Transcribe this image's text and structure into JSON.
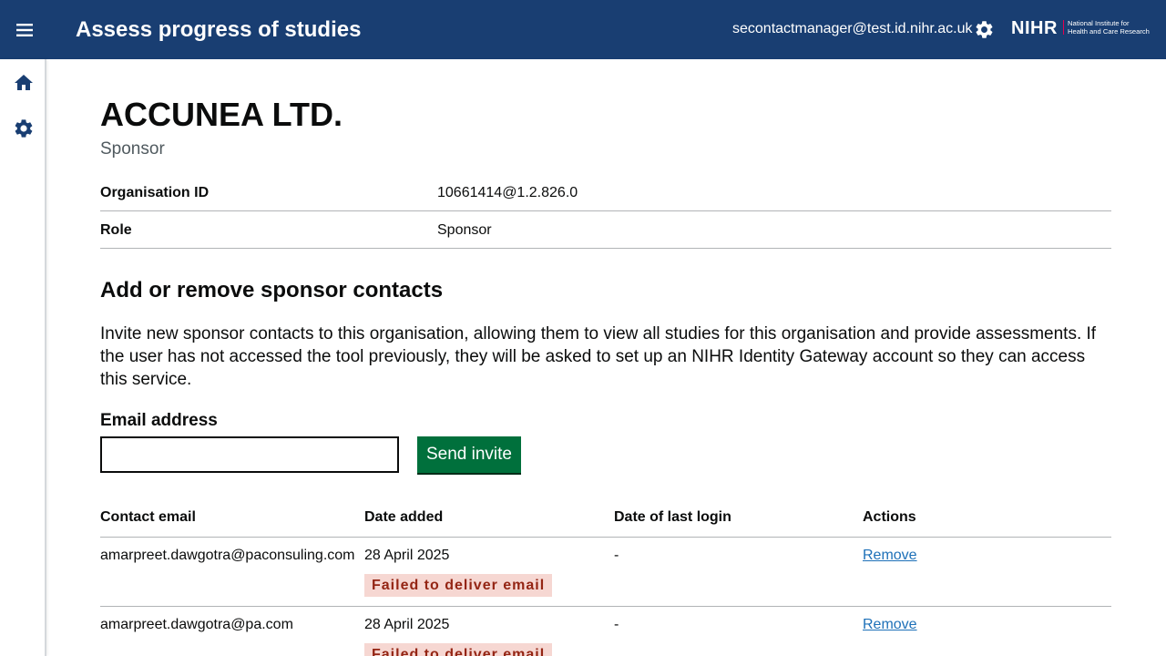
{
  "header": {
    "title": "Assess progress of studies",
    "user_email": "secontactmanager@test.id.nihr.ac.uk",
    "logo_text": "NIHR",
    "logo_line1": "National Institute for",
    "logo_line2": "Health and Care Research"
  },
  "icons": {
    "menu": "menu-icon",
    "settings_header": "gear-icon",
    "home": "home-icon",
    "settings_nav": "gear-icon"
  },
  "colors": {
    "header_bg": "#193e72",
    "button_green": "#00703c",
    "link_blue": "#1d70b8",
    "tag_bg": "#f6d7d2",
    "tag_text": "#942514"
  },
  "organisation": {
    "name": "ACCUNEA LTD.",
    "caption": "Sponsor",
    "summary": [
      {
        "key": "Organisation ID",
        "value": "10661414@1.2.826.0"
      },
      {
        "key": "Role",
        "value": "Sponsor"
      }
    ]
  },
  "contacts_section": {
    "heading": "Add or remove sponsor contacts",
    "description": "Invite new sponsor contacts to this organisation, allowing them to view all studies for this organisation and provide assessments. If the user has not accessed the tool previously, they will be asked to set up an NIHR Identity Gateway account so they can access this service.",
    "email_label": "Email address",
    "email_value": "",
    "send_button": "Send invite"
  },
  "table": {
    "headers": [
      "Contact email",
      "Date added",
      "Date of last login",
      "Actions"
    ],
    "rows": [
      {
        "email": "amarpreet.dawgotra@paconsuling.com",
        "date_added": "28 April 2025",
        "last_login": "-",
        "action": "Remove",
        "status": "Failed to deliver email"
      },
      {
        "email": "amarpreet.dawgotra@pa.com",
        "date_added": "28 April 2025",
        "last_login": "-",
        "action": "Remove",
        "status": "Failed to deliver email"
      }
    ]
  }
}
